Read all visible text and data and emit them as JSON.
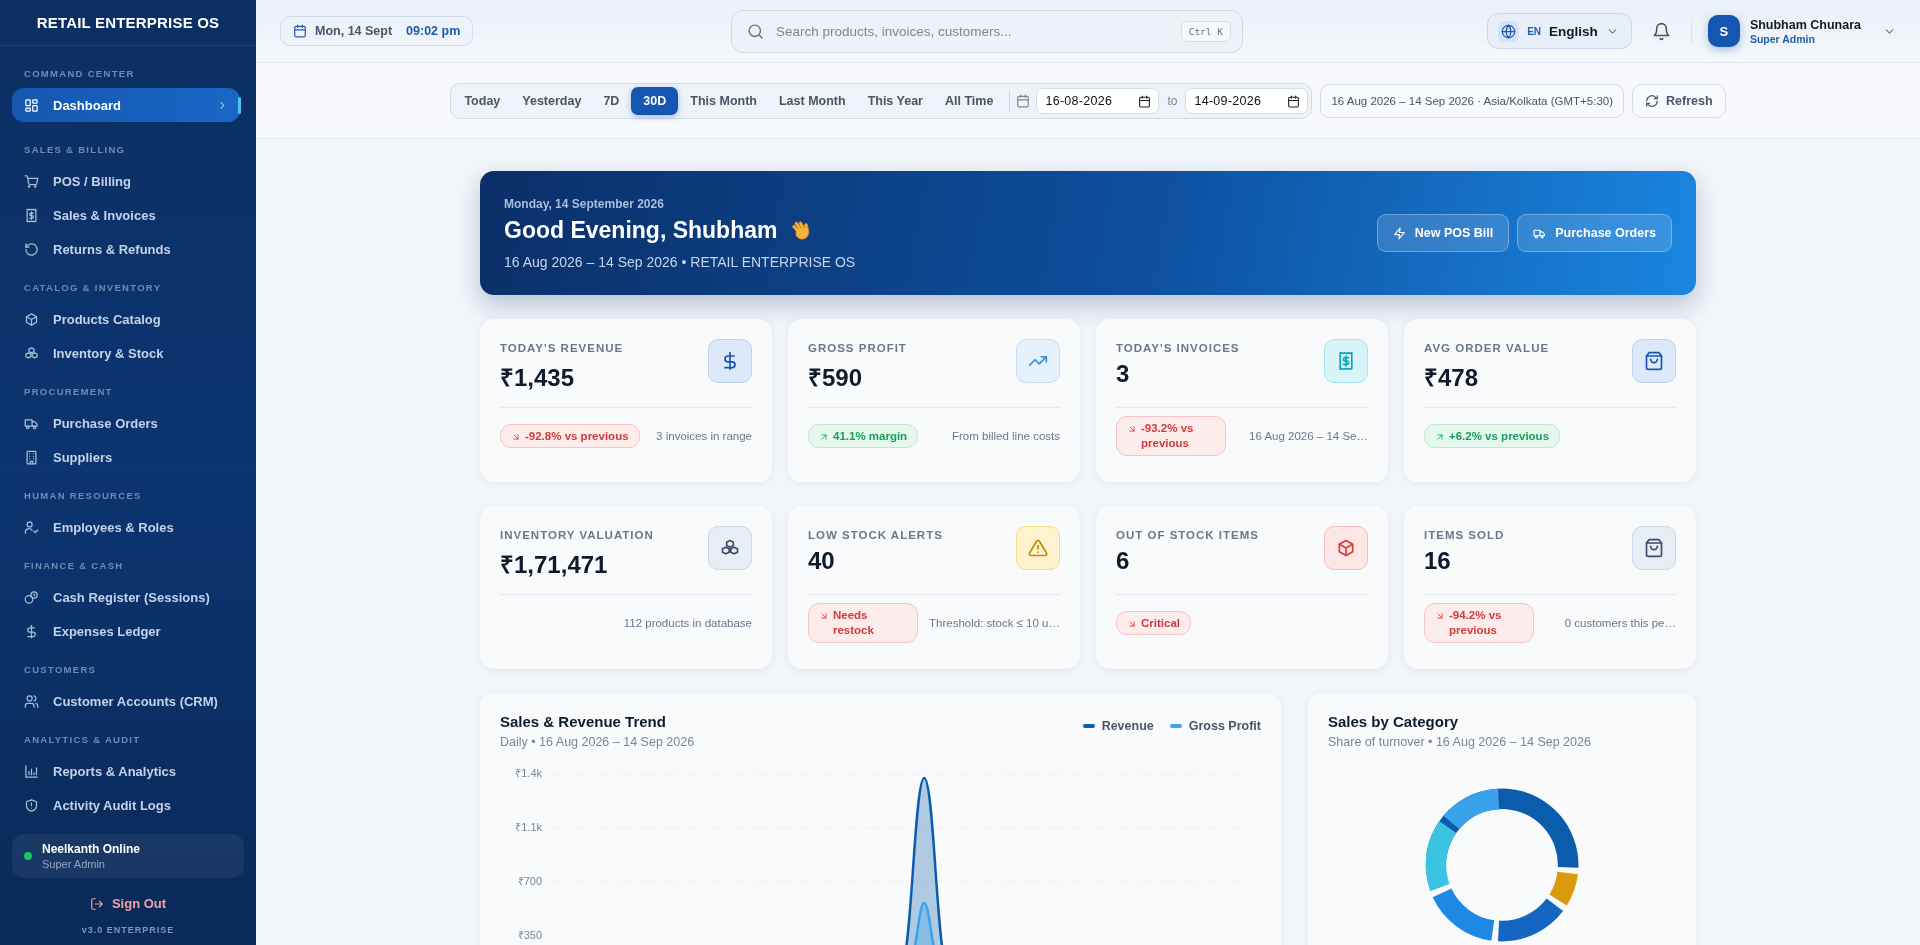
{
  "sidebar": {
    "brand": "RETAIL ENTERPRISE OS",
    "sections": [
      {
        "title": "COMMAND CENTER",
        "items": [
          {
            "label": "Dashboard",
            "selected": true
          }
        ]
      },
      {
        "title": "SALES & BILLING",
        "items": [
          {
            "label": "POS / Billing",
            "selected": false
          },
          {
            "label": "Sales & Invoices",
            "selected": false
          },
          {
            "label": "Returns & Refunds",
            "selected": false
          }
        ]
      },
      {
        "title": "CATALOG & INVENTORY",
        "items": [
          {
            "label": "Products Catalog",
            "selected": false
          },
          {
            "label": "Inventory & Stock",
            "selected": false
          }
        ]
      },
      {
        "title": "PROCUREMENT",
        "items": [
          {
            "label": "Purchase Orders",
            "selected": false
          },
          {
            "label": "Suppliers",
            "selected": false
          }
        ]
      },
      {
        "title": "HUMAN RESOURCES",
        "items": [
          {
            "label": "Employees & Roles",
            "selected": false
          }
        ]
      },
      {
        "title": "FINANCE & CASH",
        "items": [
          {
            "label": "Cash Register (Sessions)",
            "selected": false
          },
          {
            "label": "Expenses Ledger",
            "selected": false
          }
        ]
      },
      {
        "title": "CUSTOMERS",
        "items": [
          {
            "label": "Customer Accounts (CRM)",
            "selected": false
          }
        ]
      },
      {
        "title": "ANALYTICS & AUDIT",
        "items": [
          {
            "label": "Reports & Analytics",
            "selected": false
          },
          {
            "label": "Activity Audit Logs",
            "selected": false
          }
        ]
      }
    ],
    "user": {
      "name": "Neelkanth Online",
      "role": "Super Admin",
      "online": true
    },
    "sign_out": "Sign Out",
    "version": "v3.0 ENTERPRISE"
  },
  "topbar": {
    "date": "Mon, 14 Sept",
    "time": "09:02 pm",
    "search": {
      "placeholder": "Search products, invoices, customers...",
      "shortcut": "Ctrl K"
    },
    "language": {
      "code": "EN",
      "label": "English"
    },
    "user": {
      "initial": "S",
      "name": "Shubham Chunara",
      "role": "Super Admin"
    }
  },
  "filters": {
    "ranges": [
      {
        "label": "Today",
        "selected": false
      },
      {
        "label": "Yesterday",
        "selected": false
      },
      {
        "label": "7D",
        "selected": false
      },
      {
        "label": "30D",
        "selected": true
      },
      {
        "label": "This Month",
        "selected": false
      },
      {
        "label": "Last Month",
        "selected": false
      },
      {
        "label": "This Year",
        "selected": false
      },
      {
        "label": "All Time",
        "selected": false
      }
    ],
    "from": "16-08-2026",
    "to_label": "to",
    "to": "14-09-2026",
    "range_summary": "16 Aug 2026 – 14 Sep 2026 · Asia/Kolkata (GMT+5:30)",
    "refresh": "Refresh"
  },
  "hero": {
    "date": "Monday, 14 September 2026",
    "greeting": "Good Evening, Shubham",
    "subtitle": "16 Aug 2026 – 14 Sep 2026 • RETAIL ENTERPRISE OS",
    "actions": [
      "New POS Bill",
      "Purchase Orders"
    ]
  },
  "stats": [
    {
      "label": "TODAY'S REVENUE",
      "value": "₹1,435",
      "badge": "-92.8% vs previous",
      "positive": false,
      "note": "3 invoices in range"
    },
    {
      "label": "GROSS PROFIT",
      "value": "₹590",
      "badge": "41.1% margin",
      "positive": true,
      "note": "From billed line costs"
    },
    {
      "label": "TODAY'S INVOICES",
      "value": "3",
      "badge": "-93.2% vs previous",
      "positive": false,
      "note": "16 Aug 2026 – 14 Se…"
    },
    {
      "label": "AVG ORDER VALUE",
      "value": "₹478",
      "badge": "+6.2% vs previous",
      "positive": true
    },
    {
      "label": "INVENTORY VALUATION",
      "value": "₹1,71,471",
      "note": "112 products in database"
    },
    {
      "label": "LOW STOCK ALERTS",
      "value": "40",
      "badge": "Needs restock",
      "positive": false,
      "note": "Threshold: stock ≤ 10 u…"
    },
    {
      "label": "OUT OF STOCK ITEMS",
      "value": "6",
      "badge": "Critical",
      "positive": false
    },
    {
      "label": "ITEMS SOLD",
      "value": "16",
      "badge": "-94.2% vs previous",
      "positive": false,
      "note": "0 customers this pe…"
    }
  ],
  "charts": {
    "trend": {
      "title": "Sales & Revenue Trend",
      "subtitle": "Daily • 16 Aug 2026 – 14 Sep 2026",
      "legend": [
        {
          "name": "Revenue",
          "color": "#0b5cad"
        },
        {
          "name": "Gross Profit",
          "color": "#3ba3e8"
        }
      ],
      "y_labels": [
        "₹1.4k",
        "₹1.1k",
        "₹700",
        "₹350"
      ]
    },
    "category": {
      "title": "Sales by Category",
      "subtitle": "Share of turnover • 16 Aug 2026 – 14 Sep 2026"
    }
  }
}
